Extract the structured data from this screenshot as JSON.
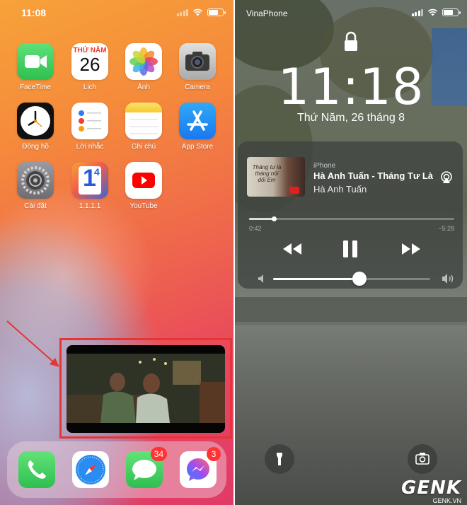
{
  "home": {
    "status": {
      "time": "11:08"
    },
    "apps": [
      {
        "name": "facetime",
        "label": "FaceTime"
      },
      {
        "name": "calendar",
        "label": "Lịch",
        "weekday": "THỨ NĂM",
        "day": "26"
      },
      {
        "name": "photos",
        "label": "Ảnh"
      },
      {
        "name": "camera",
        "label": "Camera"
      },
      {
        "name": "clock",
        "label": "Đồng hồ"
      },
      {
        "name": "reminders",
        "label": "Lời nhắc"
      },
      {
        "name": "notes",
        "label": "Ghi chú"
      },
      {
        "name": "app-store",
        "label": "App Store"
      },
      {
        "name": "settings",
        "label": "Cài đặt"
      },
      {
        "name": "1111",
        "label": "1.1.1.1",
        "icon_text": "1",
        "icon_sup": "4"
      },
      {
        "name": "youtube",
        "label": "YouTube"
      }
    ],
    "dock": [
      {
        "name": "phone"
      },
      {
        "name": "safari"
      },
      {
        "name": "messages",
        "badge": "34"
      },
      {
        "name": "messenger",
        "badge": "3"
      }
    ]
  },
  "lock": {
    "status": {
      "carrier": "VinaPhone"
    },
    "time": "11:18",
    "date": "Thứ Năm, 26 tháng 8",
    "player": {
      "source": "iPhone",
      "title": "Hà Anh Tuấn - Tháng Tư Là",
      "artist": "Hà Anh Tuấn",
      "elapsed": "0:42",
      "remaining": "−5:28",
      "progress": 0.12,
      "volume": 0.55,
      "artwork_text": "Tháng tư là tháng nói dối Em"
    }
  },
  "watermark": {
    "brand": "GENK",
    "domain": "GENK.VN"
  },
  "colors": {
    "highlight": "#e53535"
  }
}
